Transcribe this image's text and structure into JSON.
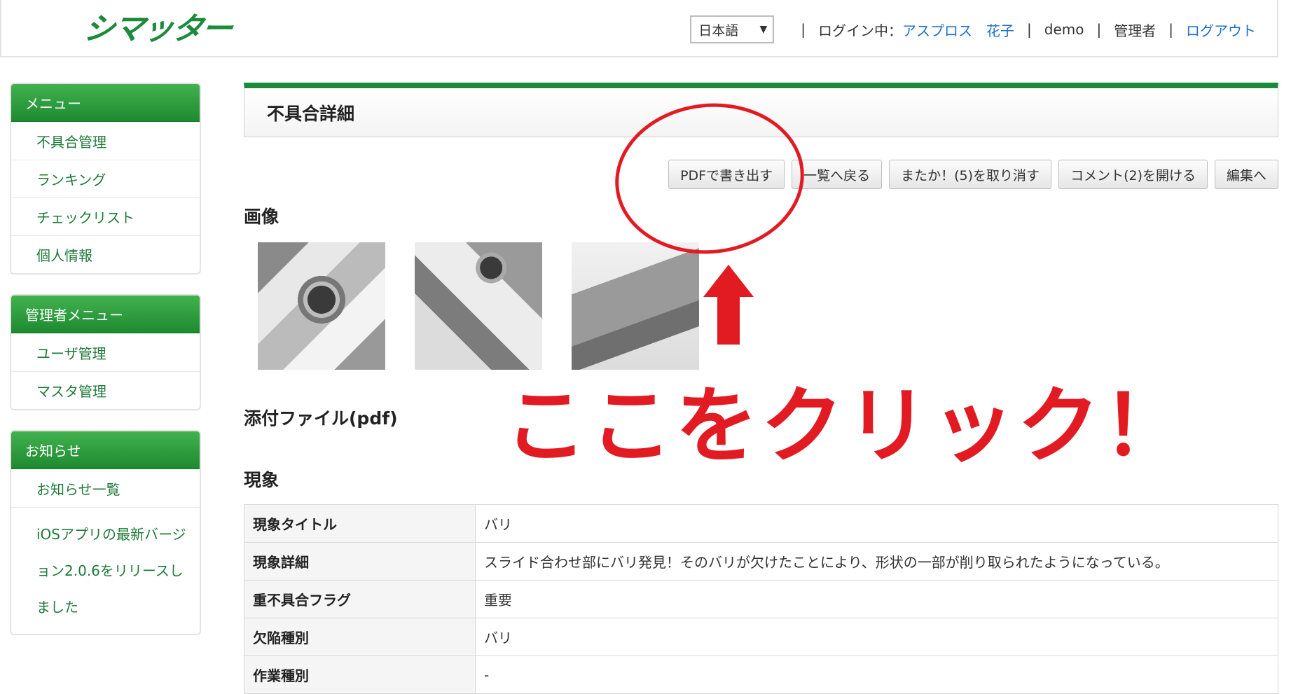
{
  "header": {
    "logo": "シマッター",
    "language": "日本語",
    "login_label": "ログイン中：",
    "user_name": "アスプロス　花子",
    "company": "demo",
    "role": "管理者",
    "logout": "ログアウト"
  },
  "sidebar": {
    "menu": {
      "title": "メニュー",
      "items": [
        "不具合管理",
        "ランキング",
        "チェックリスト",
        "個人情報"
      ]
    },
    "admin_menu": {
      "title": "管理者メニュー",
      "items": [
        "ユーザ管理",
        "マスタ管理"
      ]
    },
    "news": {
      "title": "お知らせ",
      "items": [
        "お知らせ一覧",
        "iOSアプリの最新バージョン2.0.6をリリースしました"
      ]
    }
  },
  "main": {
    "title": "不具合詳細",
    "buttons": {
      "pdf": "PDFで書き出す",
      "back": "一覧へ戻る",
      "cancel_again": "またか！(5)を取り消す",
      "open_comments": "コメント(2)を開ける",
      "edit": "編集へ"
    },
    "images_label": "画像",
    "attachments_label": "添付ファイル(pdf)",
    "phenomenon_label": "現象",
    "table": [
      {
        "key": "現象タイトル",
        "value": "バリ"
      },
      {
        "key": "現象詳細",
        "value": "スライド合わせ部にバリ発見！そのバリが欠けたことにより、形状の一部が削り取られたようになっている。"
      },
      {
        "key": "重不具合フラグ",
        "value": "重要"
      },
      {
        "key": "欠陥種別",
        "value": "バリ"
      },
      {
        "key": "作業種別",
        "value": "-"
      }
    ]
  },
  "annotation": {
    "text": "ここをクリック！",
    "color": "#e21b23"
  },
  "colors": {
    "brand_green": "#1b8a3a",
    "link_blue": "#1d6fc8"
  }
}
